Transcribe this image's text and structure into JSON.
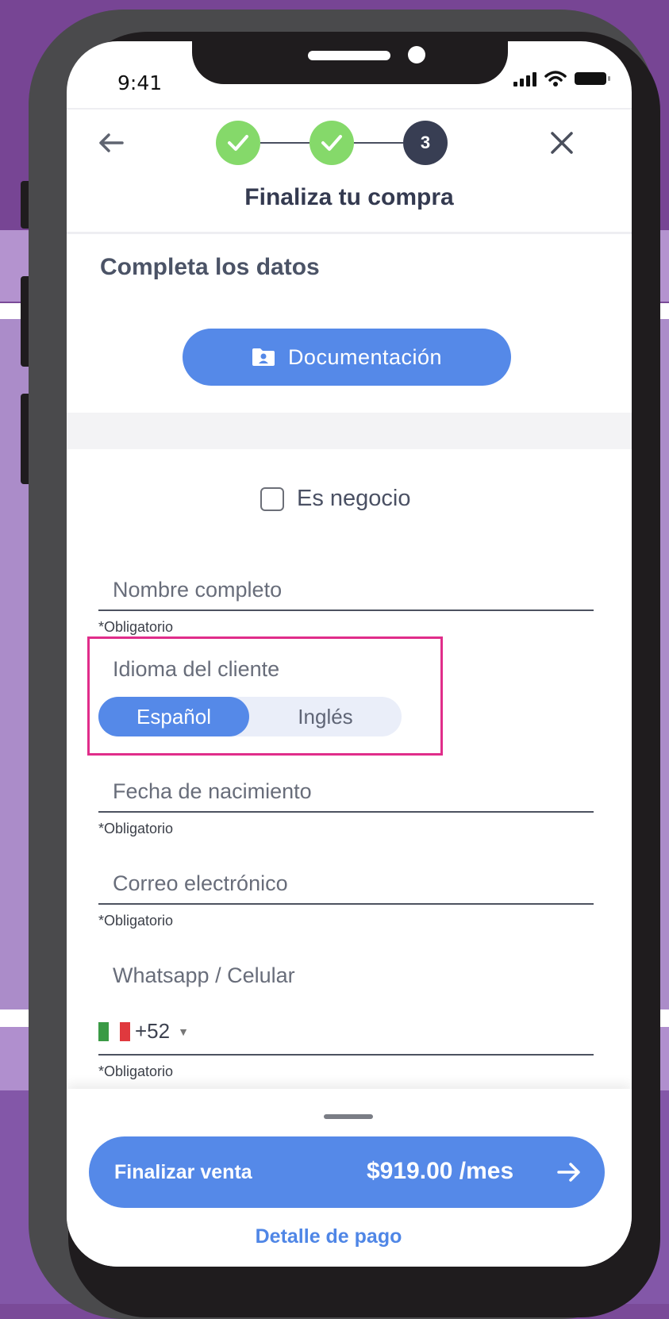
{
  "status_bar": {
    "time": "9:41"
  },
  "header": {
    "title": "Finaliza tu compra",
    "current_step": "3"
  },
  "form": {
    "section_title": "Completa los datos",
    "documentation_button": "Documentación",
    "business_checkbox_label": "Es negocio",
    "full_name_label": "Nombre completo",
    "full_name_help": "*Obligatorio",
    "language_label": "Idioma del cliente",
    "language_options": [
      "Español",
      "Inglés"
    ],
    "language_selected": "Español",
    "birthdate_label": "Fecha de nacimiento",
    "birthdate_help": "*Obligatorio",
    "email_label": "Correo electrónico",
    "email_help": "*Obligatorio",
    "phone_label": "Whatsapp / Celular",
    "phone_country_code": "+52",
    "phone_help": "*Obligatorio"
  },
  "footer": {
    "cta_label": "Finalizar venta",
    "cta_price": "$919.00 /mes",
    "payment_detail_link": "Detalle de pago"
  },
  "colors": {
    "accent": "#5589e8",
    "step_done": "#85d96a",
    "step_current": "#383e53",
    "highlight_border": "#e02d8a"
  }
}
